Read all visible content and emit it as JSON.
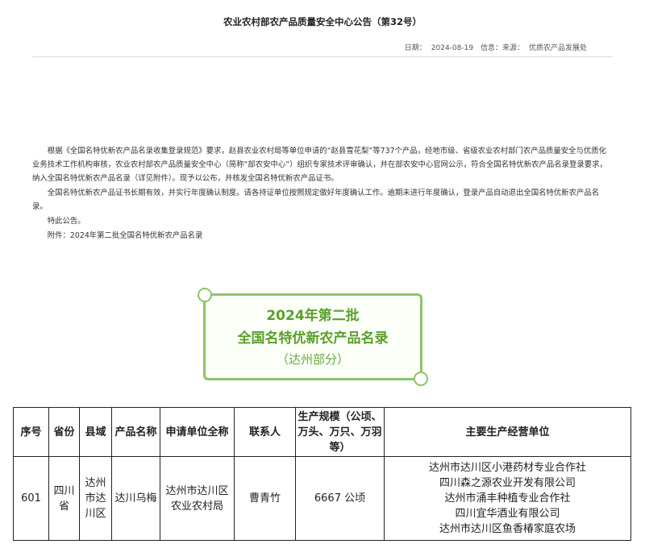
{
  "notice": {
    "title": "农业农村部农产品质量安全中心公告（第32号）",
    "meta": {
      "date_label": "日期：",
      "date": "2024-08-19",
      "source_label": "信息：来源：",
      "source": "优质农产品发展处"
    },
    "paragraphs": [
      "根据《全国名特优新农产品名录收集登录规范》要求，赵县农业农村局等单位申请的“赵县雪花梨”等737个产品，经地市级、省级农业农村部门农产品质量安全与优质化业务技术工作机构审核，农业农村部农产品质量安全中心（简称“部农安中心”）组织专家技术评审确认，并在部农安中心官网公示，符合全国名特优新农产品名录登录要求，纳入全国名特优新农产品名录（详见附件）。现予以公布，并核发全国名特优新农产品证书。",
      "全国名特优新农产品证书长期有效，并实行年度确认制度。请各持证单位按照规定做好年度确认工作。逾期未进行年度确认，登录产品自动退出全国名特优新农产品名录。",
      "特此公告。",
      "附件：2024年第二批全国名特优新农产品名录"
    ]
  },
  "banner": {
    "line1": "2024年第二批",
    "line2": "全国名特优新农产品名录",
    "line3": "（达州部分）"
  },
  "table": {
    "headers": [
      "序号",
      "省份",
      "县域",
      "产品名称",
      "申请单位全称",
      "联系人",
      "生产规模（公顷、万头、万只、万羽等）",
      "主要生产经营单位"
    ],
    "row": {
      "no": "601",
      "province": "四川省",
      "county": "达州市达川区",
      "product": "达川乌梅",
      "applicant": "达州市达川区农业农村局",
      "contact": "曹青竹",
      "scale": "6667 公顷",
      "units": [
        "达州市达川区小港药材专业合作社",
        "四川森之源农业开发有限公司",
        "达州市涌丰种植专业合作社",
        "四川宜华酒业有限公司",
        "达州市达川区鱼香椿家庭农场"
      ]
    }
  }
}
